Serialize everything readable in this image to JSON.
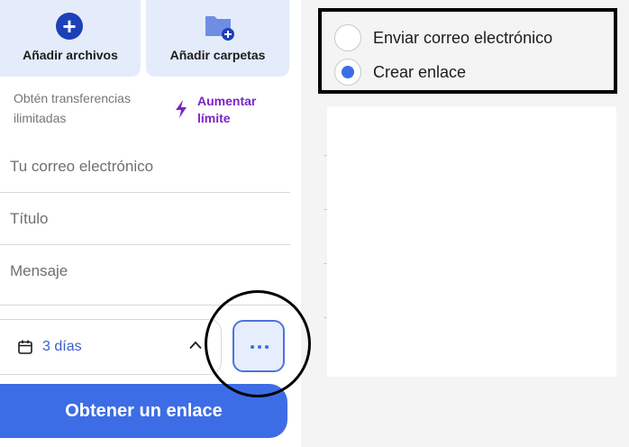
{
  "upload": {
    "files_label": "Añadir archivos",
    "folders_label": "Añadir carpetas"
  },
  "promo": {
    "text": "Obtén transferencias ilimitadas",
    "boost_label": "Aumentar límite"
  },
  "form": {
    "email_placeholder": "Tu correo electrónico",
    "title_placeholder": "Título",
    "message_placeholder": "Mensaje",
    "expiry_value": "3 días",
    "submit_label": "Obtener un enlace"
  },
  "share_mode": {
    "options": [
      {
        "label": "Enviar correo electrónico",
        "selected": false
      },
      {
        "label": "Crear enlace",
        "selected": true
      }
    ]
  },
  "colors": {
    "accent": "#3d6de6",
    "promo": "#7b24c6",
    "tile_bg": "#e4ecfb"
  }
}
